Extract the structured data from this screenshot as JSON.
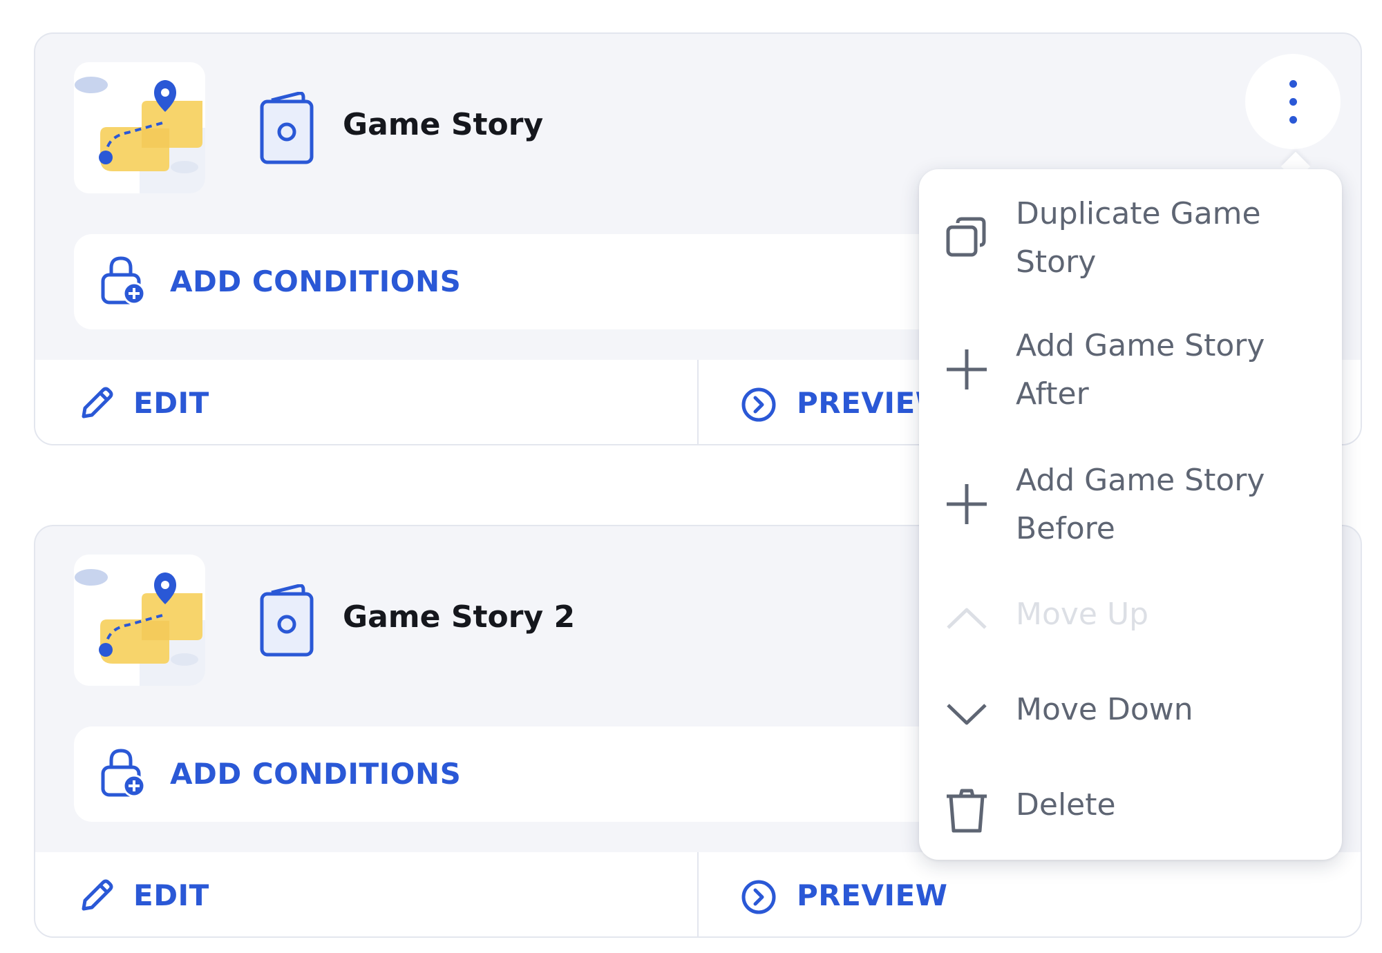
{
  "cards": [
    {
      "title": "Game Story",
      "conditions_label": "ADD CONDITIONS",
      "edit_label": "EDIT",
      "preview_label": "PREVIEW"
    },
    {
      "title": "Game Story 2",
      "conditions_label": "ADD CONDITIONS",
      "edit_label": "EDIT",
      "preview_label": "PREVIEW"
    }
  ],
  "context_menu": {
    "items": [
      {
        "label": "Duplicate Game Story",
        "icon": "duplicate-icon",
        "enabled": true
      },
      {
        "label": "Add Game Story After",
        "icon": "plus-icon",
        "enabled": true
      },
      {
        "label": "Add Game Story Before",
        "icon": "plus-icon",
        "enabled": true
      },
      {
        "label": "Move Up",
        "icon": "chevron-up-icon",
        "enabled": false
      },
      {
        "label": "Move Down",
        "icon": "chevron-down-icon",
        "enabled": true
      },
      {
        "label": "Delete",
        "icon": "trash-icon",
        "enabled": true
      }
    ]
  },
  "icons": {
    "more": "more-vertical-icon",
    "story_thumbnail": "map-route-thumbnail",
    "story_type": "story-document-icon",
    "conditions": "lock-plus-icon",
    "edit": "pencil-icon",
    "preview": "play-circle-icon"
  },
  "colors": {
    "accent": "#2a58d6",
    "card_background": "#f4f5f9",
    "menu_text": "#5e6573",
    "menu_text_disabled": "#dcdfe5",
    "title_text": "#15171d",
    "thumbnail_yellow": "#f7d46b"
  }
}
